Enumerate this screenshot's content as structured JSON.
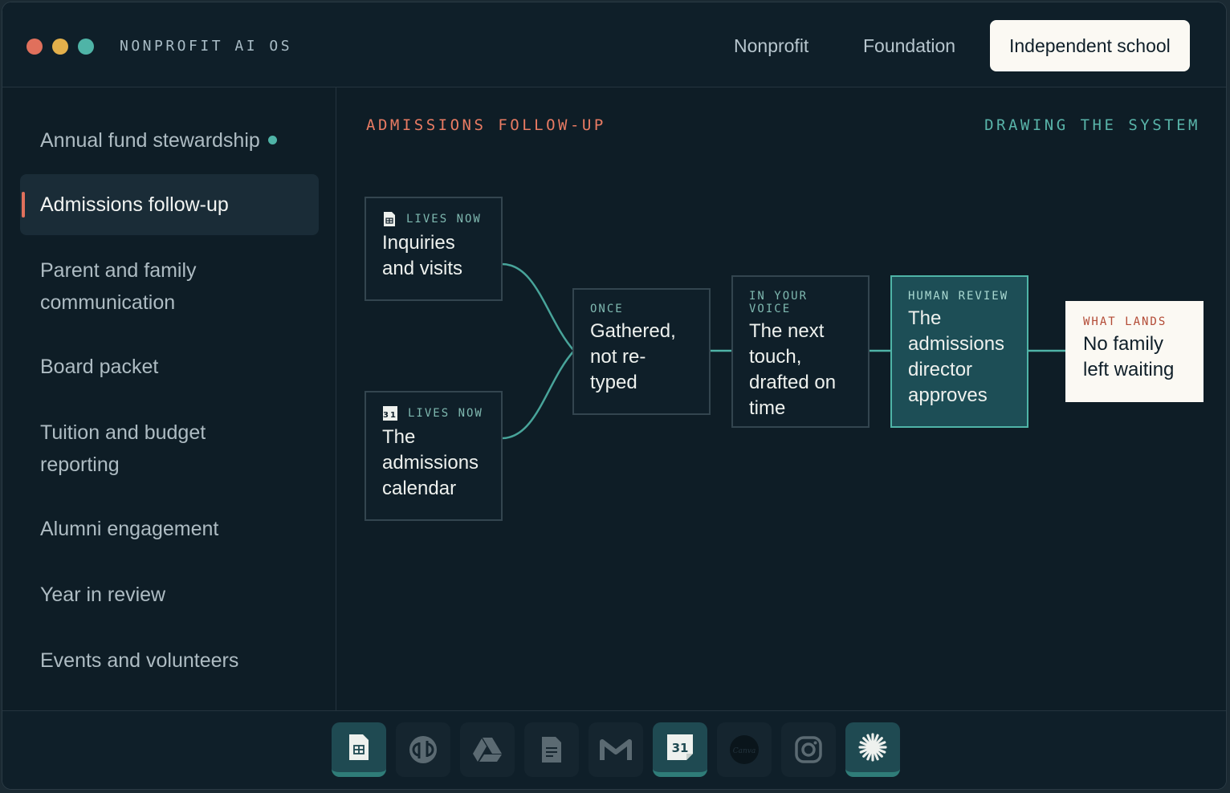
{
  "window": {
    "app_title": "NONPROFIT AI OS",
    "tabs": [
      {
        "label": "Nonprofit",
        "active": false
      },
      {
        "label": "Foundation",
        "active": false
      },
      {
        "label": "Independent school",
        "active": true
      }
    ]
  },
  "sidebar": {
    "items": [
      {
        "label": "Annual fund stewardship",
        "status_dot": true
      },
      {
        "label": "Admissions follow-up",
        "active": true
      },
      {
        "label": "Parent and family communication"
      },
      {
        "label": "Board packet"
      },
      {
        "label": "Tuition and budget reporting"
      },
      {
        "label": "Alumni engagement"
      },
      {
        "label": "Year in review"
      },
      {
        "label": "Events and volunteers"
      }
    ]
  },
  "main": {
    "title": "ADMISSIONS FOLLOW-UP",
    "status": "DRAWING THE SYSTEM",
    "nodes": [
      {
        "tag": "LIVES NOW",
        "text": "Inquiries and visits",
        "icon": "sheets-icon"
      },
      {
        "tag": "LIVES NOW",
        "text": "The admissions calendar",
        "icon": "calendar-icon"
      },
      {
        "tag": "ONCE",
        "text": "Gathered, not re-typed"
      },
      {
        "tag": "IN YOUR VOICE",
        "text": "The next touch, drafted on time"
      },
      {
        "tag": "HUMAN REVIEW",
        "text": "The admissions director approves"
      },
      {
        "tag": "WHAT LANDS",
        "text": "No family left waiting"
      }
    ]
  },
  "colors": {
    "accent": "#e97b63",
    "teal": "#4fb4a7",
    "background": "#0e1d26",
    "human_review": "#1d4e56",
    "lands": "#fbf9f3"
  },
  "dock": {
    "items": [
      {
        "icon": "google-sheets-icon",
        "active": true
      },
      {
        "icon": "quickbooks-icon",
        "active": false
      },
      {
        "icon": "google-drive-icon",
        "active": false
      },
      {
        "icon": "google-docs-icon",
        "active": false
      },
      {
        "icon": "gmail-icon",
        "active": false
      },
      {
        "icon": "google-calendar-icon",
        "active": true,
        "text": "31"
      },
      {
        "icon": "canva-icon",
        "active": false,
        "text": "Canva"
      },
      {
        "icon": "instagram-icon",
        "active": false
      },
      {
        "icon": "claude-icon",
        "active": true
      }
    ]
  }
}
